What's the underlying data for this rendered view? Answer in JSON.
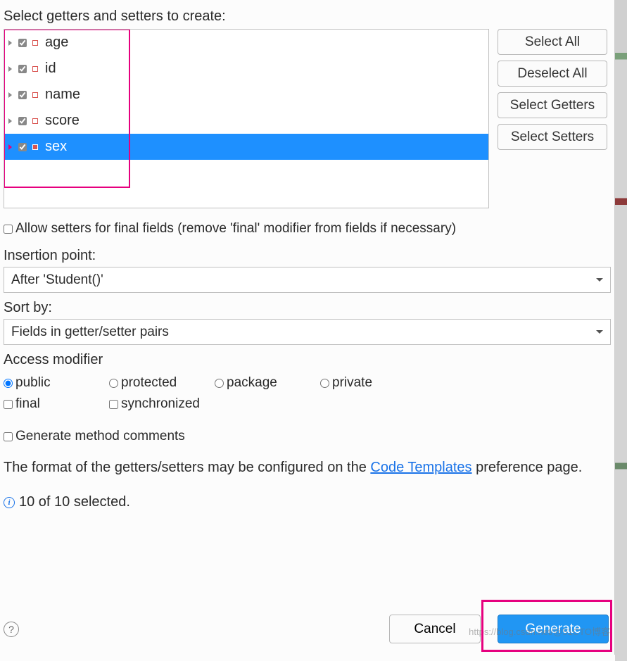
{
  "title": "Select getters and setters to create:",
  "fields": [
    {
      "label": "age",
      "checked": true,
      "selected": false
    },
    {
      "label": "id",
      "checked": true,
      "selected": false
    },
    {
      "label": "name",
      "checked": true,
      "selected": false
    },
    {
      "label": "score",
      "checked": true,
      "selected": false
    },
    {
      "label": "sex",
      "checked": true,
      "selected": true
    }
  ],
  "side_buttons": {
    "select_all": "Select All",
    "deselect_all": "Deselect All",
    "select_getters": "Select Getters",
    "select_setters": "Select Setters"
  },
  "allow_final": {
    "label": "Allow setters for final fields (remove 'final' modifier from fields if necessary)",
    "checked": false
  },
  "insertion_point": {
    "label": "Insertion point:",
    "value": "After 'Student()'"
  },
  "sort_by": {
    "label": "Sort by:",
    "value": "Fields in getter/setter pairs"
  },
  "access_modifier": {
    "label": "Access modifier",
    "radios": {
      "public": "public",
      "protected": "protected",
      "package": "package",
      "private": "private"
    },
    "selected": "public",
    "checks": {
      "final": {
        "label": "final",
        "checked": false
      },
      "synchronized": {
        "label": "synchronized",
        "checked": false
      }
    }
  },
  "gen_comments": {
    "label": "Generate method comments",
    "checked": false
  },
  "hint": {
    "pre": "The format of the getters/setters may be configured on the ",
    "link": "Code Templates",
    "post": " preference page."
  },
  "status": "10 of 10 selected.",
  "buttons": {
    "cancel": "Cancel",
    "generate": "Generate"
  },
  "watermark": "https://blog.csdn.net/@51CTO博客"
}
